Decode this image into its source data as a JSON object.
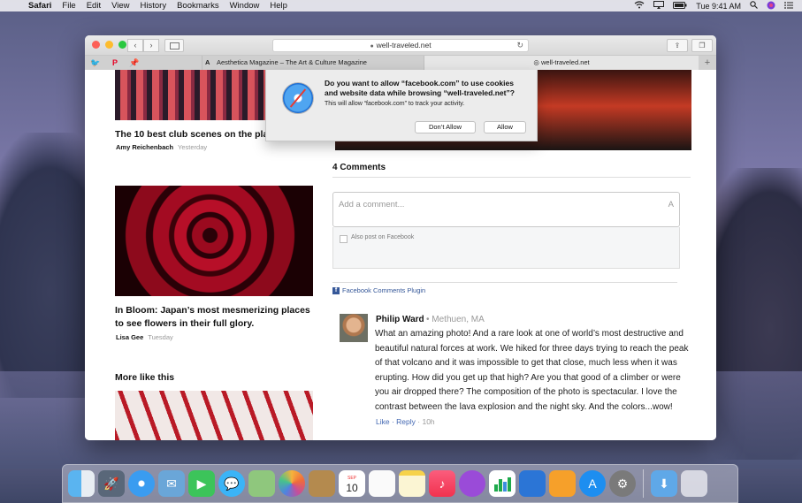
{
  "menubar": {
    "app_name": "Safari",
    "items": [
      "File",
      "Edit",
      "View",
      "History",
      "Bookmarks",
      "Window",
      "Help"
    ],
    "clock": "Tue 9:41 AM"
  },
  "toolbar": {
    "url": "well-traveled.net"
  },
  "tabs": [
    {
      "label": "Aesthetica Magazine – The Art & Culture Magazine"
    },
    {
      "label": "well-traveled.net"
    }
  ],
  "dialog": {
    "title": "Do you want to allow “facebook.com” to use cookies and website data while browsing “well-traveled.net”?",
    "subtitle": "This will allow “facebook.com” to track your activity.",
    "dont_allow": "Don’t Allow",
    "allow": "Allow"
  },
  "articles": [
    {
      "title": "The 10 best club scenes on the plan",
      "author": "Amy Reichenbach",
      "time": "Yesterday"
    },
    {
      "title": "In Bloom: Japan’s most mesmerizing places to see flowers in their full glory.",
      "author": "Lisa Gee",
      "time": "Tuesday"
    }
  ],
  "more_like": "More like this",
  "comments": {
    "count_label": "4 Comments",
    "input_placeholder": "Add a comment...",
    "input_a": "A",
    "post_on_facebook": "Also post on Facebook",
    "plugin_label": "Facebook Comments Plugin",
    "items": [
      {
        "name": "Philip Ward",
        "location": "• Methuen, MA",
        "text": "What an amazing photo! And a rare look at one of world’s most destructive and beautiful natural forces at work. We hiked for three days trying to reach the peak of that volcano and it was impossible to get that close, much less when it was erupting. How did you get up that high? Are you that good of a climber or were you air dropped there? The composition of the photo is spectacular. I love the contrast between the lava explosion and the night sky. And the colors...wow!",
        "like": "Like",
        "reply": "Reply",
        "time": "10h"
      }
    ]
  },
  "dock_apps": [
    "finder-icon",
    "launchpad-icon",
    "safari-icon",
    "mail-icon",
    "facetime-icon",
    "messages-icon",
    "maps-icon",
    "photos-icon",
    "contacts-icon",
    "calendar-icon",
    "reminders-icon",
    "notes-icon",
    "music-icon",
    "podcasts-icon",
    "numbers-icon",
    "keynote-icon",
    "pages-icon",
    "app-store-icon",
    "system-preferences-icon",
    "downloads-icon",
    "trash-icon"
  ],
  "calendar_date": {
    "month": "SEP",
    "day": "10"
  }
}
